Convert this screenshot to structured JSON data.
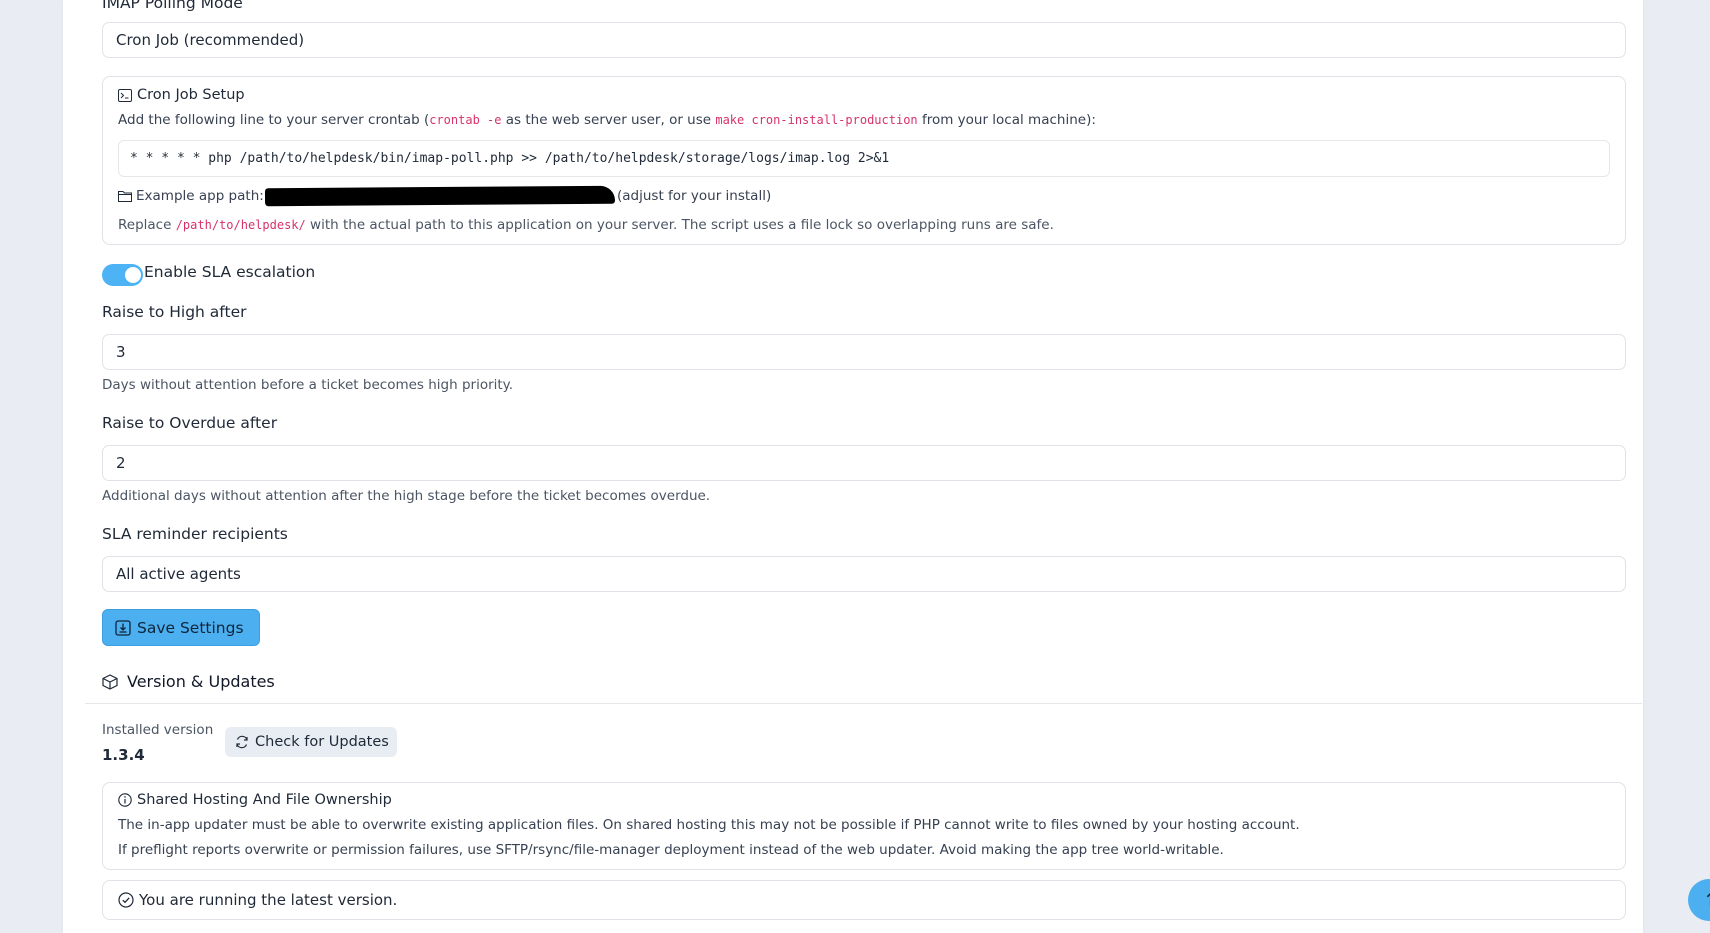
{
  "imap": {
    "label": "IMAP Polling Mode",
    "value": "Cron Job (recommended)"
  },
  "cron": {
    "title": "Cron Job Setup",
    "instr_prefix": "Add the following line to your server crontab (",
    "instr_code1": "crontab -e",
    "instr_mid": " as the web server user, or use ",
    "instr_code2": "make cron-install-production",
    "instr_suffix": " from your local machine):",
    "command": "* * * * * php /path/to/helpdesk/bin/imap-poll.php >> /path/to/helpdesk/storage/logs/imap.log 2>&1",
    "example_label": "Example app path:",
    "example_suffix": "(adjust for your install)",
    "replace_prefix": "Replace ",
    "replace_code": "/path/to/helpdesk/",
    "replace_suffix": " with the actual path to this application on your server. The script uses a file lock so overlapping runs are safe."
  },
  "sla": {
    "toggle_label": "Enable SLA escalation",
    "toggle_on": true,
    "high_label": "Raise to High after",
    "high_value": "3",
    "high_help": "Days without attention before a ticket becomes high priority.",
    "overdue_label": "Raise to Overdue after",
    "overdue_value": "2",
    "overdue_help": "Additional days without attention after the high stage before the ticket becomes overdue.",
    "recipients_label": "SLA reminder recipients",
    "recipients_value": "All active agents"
  },
  "save_button": "Save Settings",
  "version": {
    "section_title": "Version & Updates",
    "installed_label": "Installed version",
    "installed_value": "1.3.4",
    "check_button": "Check for Updates",
    "hosting_title": "Shared Hosting And File Ownership",
    "hosting_line1": "The in-app updater must be able to overwrite existing application files. On shared hosting this may not be possible if PHP cannot write to files owned by your hosting account.",
    "hosting_line2": "If preflight reports overwrite or permission failures, use SFTP/rsync/file-manager deployment instead of the web updater. Avoid making the app tree world-writable.",
    "status": "You are running the latest version."
  },
  "colors": {
    "accent": "#4cb0f0",
    "code_pink": "#d6336c",
    "background": "#e9edf3"
  },
  "icons": {
    "terminal": "terminal-icon",
    "folder": "folder-icon",
    "save": "save-icon",
    "box": "box-icon",
    "refresh": "refresh-icon",
    "info": "info-icon",
    "check": "check-circle-icon",
    "scroll_top": "arrow-up-icon"
  }
}
